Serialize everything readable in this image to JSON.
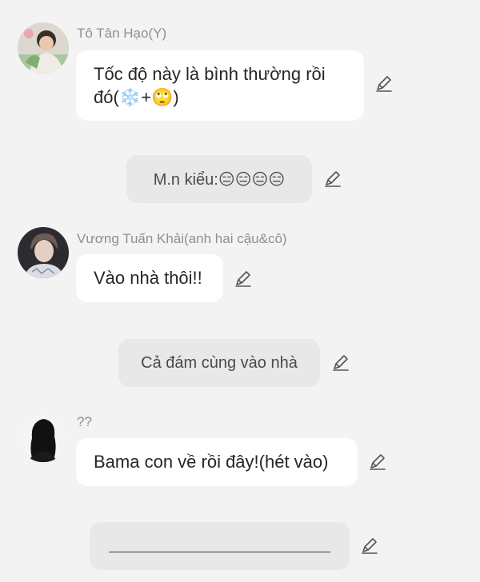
{
  "messages": [
    {
      "author": "Tô Tân Hạo(Y)",
      "text": "Tốc độ này là bình thường rồi đó(❄️+🙄)"
    },
    {
      "narration": "M.n kiểu:😑😑😑😑"
    },
    {
      "author": "Vương Tuấn Khải(anh hai cậu&cô)",
      "text": "Vào nhà thôi!!"
    },
    {
      "narration": "Cả đám cùng vào nhà"
    },
    {
      "author": "??",
      "text": "Bama con về rồi đây!(hét vào)"
    },
    {
      "input_value": ""
    }
  ],
  "icons": {
    "edit": "pencil-edit-icon",
    "avatar1": "avatar-photo-boy-green",
    "avatar2": "avatar-photo-boy-dark",
    "avatar3": "avatar-silhouette-long-hair"
  },
  "colors": {
    "background": "#f3f3f3",
    "bubble": "#ffffff",
    "narration": "#e8e8e8",
    "author_name": "#8f8f8f"
  }
}
